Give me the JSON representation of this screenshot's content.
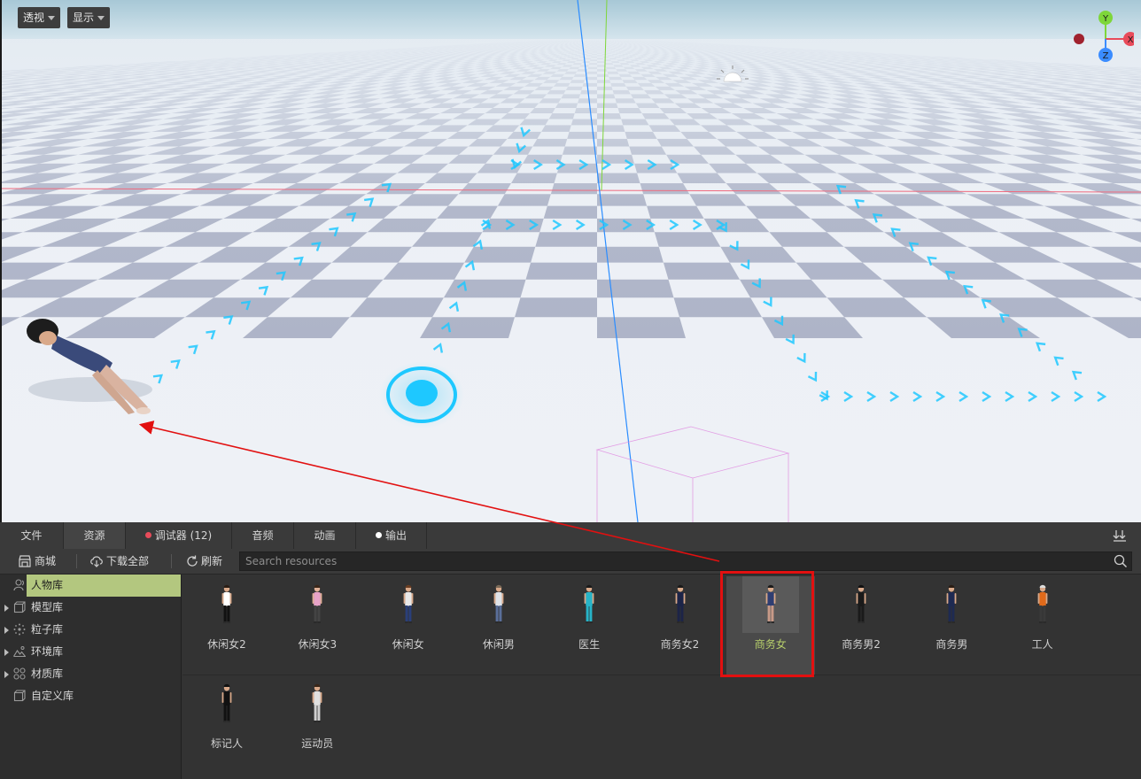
{
  "viewport": {
    "view_mode_label": "透视",
    "display_label": "显示",
    "gizmo_axes": {
      "y": "Y",
      "x": "X",
      "z": "Z"
    }
  },
  "tabs": [
    {
      "label": "文件",
      "active": false
    },
    {
      "label": "资源",
      "active": true
    },
    {
      "label": "调试器 (12)",
      "active": false,
      "dot_color": "#e84b5a"
    },
    {
      "label": "音频",
      "active": false
    },
    {
      "label": "动画",
      "active": false
    },
    {
      "label": "输出",
      "active": false,
      "dot_color": "#ffffff"
    }
  ],
  "toolbar": {
    "store_label": "商城",
    "download_all_label": "下载全部",
    "refresh_label": "刷新",
    "search_placeholder": "Search resources"
  },
  "sidebar": {
    "items": [
      {
        "label": "人物库",
        "icon": "person-icon",
        "active": true
      },
      {
        "label": "模型库",
        "icon": "cube-icon",
        "expandable": true
      },
      {
        "label": "粒子库",
        "icon": "particle-icon",
        "expandable": true
      },
      {
        "label": "环境库",
        "icon": "landscape-icon",
        "expandable": true
      },
      {
        "label": "材质库",
        "icon": "material-grid-icon",
        "expandable": true
      },
      {
        "label": "自定义库",
        "icon": "cube-icon",
        "expandable": false
      }
    ]
  },
  "assets": [
    {
      "name": "休闲女2",
      "top": "#ffffff",
      "bottom": "#111111",
      "skin": "#d9a98a",
      "hair": "#2a1d14"
    },
    {
      "name": "休闲女3",
      "top": "#e7a3c8",
      "bottom": "#444444",
      "skin": "#e0b097",
      "hair": "#3a2618"
    },
    {
      "name": "休闲女",
      "top": "#e8e8e8",
      "bottom": "#2a3f7a",
      "skin": "#d9a98a",
      "hair": "#6b3e22"
    },
    {
      "name": "休闲男",
      "top": "#dfe3e8",
      "bottom": "#5a6f9a",
      "skin": "#d9a98a",
      "hair": "#7a6a58"
    },
    {
      "name": "医生",
      "top": "#27b4c8",
      "bottom": "#27b4c8",
      "skin": "#d9a98a",
      "hair": "#1a1a1a"
    },
    {
      "name": "商务女2",
      "top": "#1c2448",
      "bottom": "#1c2448",
      "skin": "#d9a98a",
      "hair": "#1a1a1a"
    },
    {
      "name": "商务女",
      "top": "#2f3e72",
      "bottom": "#c89a88",
      "skin": "#d9a98a",
      "hair": "#1a1a1a",
      "selected": true
    },
    {
      "name": "商务男2",
      "top": "#1a1a1a",
      "bottom": "#1a1a1a",
      "skin": "#d9a98a",
      "hair": "#111111"
    },
    {
      "name": "商务男",
      "top": "#1e2a52",
      "bottom": "#1e2a52",
      "skin": "#d9a98a",
      "hair": "#2a1d14"
    },
    {
      "name": "工人",
      "top": "#e06a1a",
      "bottom": "#3a3a3a",
      "skin": "#d9a98a",
      "hair": "#dddddd"
    },
    {
      "name": "标记人",
      "top": "#111111",
      "bottom": "#111111",
      "skin": "#d9a98a",
      "hair": "#111111"
    },
    {
      "name": "运动员",
      "top": "#e0e0e0",
      "bottom": "#cfcfcf",
      "skin": "#d9a98a",
      "hair": "#3a2618"
    }
  ],
  "colors": {
    "accent_green": "#b3c77f",
    "selected_text": "#b7cf6b",
    "annotation_red": "#e21010",
    "path_blue": "#1ec8ff"
  }
}
